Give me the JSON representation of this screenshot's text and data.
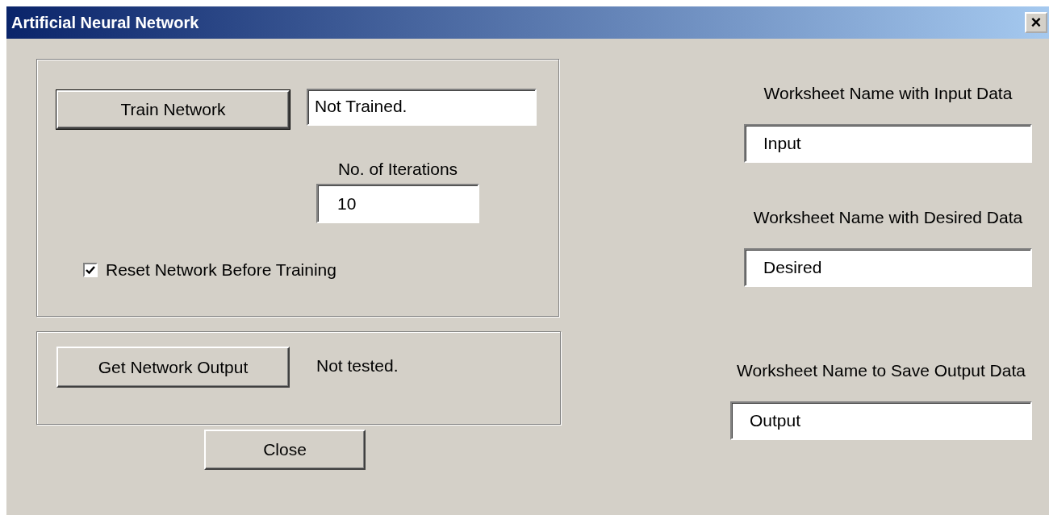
{
  "window": {
    "title": "Artificial Neural Network",
    "close": "×"
  },
  "training": {
    "train_button": "Train Network",
    "status": "Not Trained.",
    "iterations_label": "No. of Iterations",
    "iterations": "10",
    "reset": {
      "label": "Reset Network Before Training",
      "checked": true
    }
  },
  "output": {
    "button": "Get Network Output",
    "status": "Not tested."
  },
  "close_button": "Close",
  "worksheets": [
    {
      "label": "Worksheet Name with Input Data",
      "value": "Input"
    },
    {
      "label": "Worksheet Name with Desired Data",
      "value": "Desired"
    },
    {
      "label": "Worksheet Name to Save Output Data",
      "value": "Output"
    }
  ]
}
